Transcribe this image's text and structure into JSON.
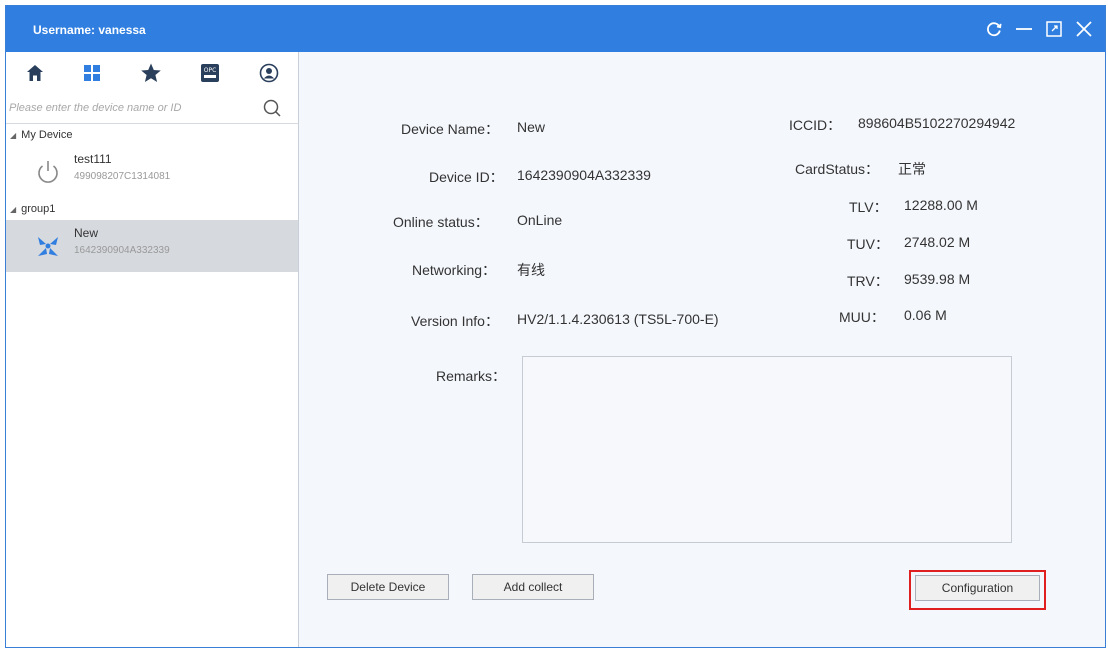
{
  "title_bar": {
    "username_label": "Username: vanessa",
    "controls": [
      "refresh-icon",
      "minimize-icon",
      "maximize-icon",
      "close-icon"
    ]
  },
  "sidebar": {
    "toolbar_icons": [
      "home-icon",
      "grid-icon",
      "star-icon",
      "opc-icon",
      "user-circle-icon"
    ],
    "search": {
      "placeholder": "Please enter the device name or ID",
      "value": ""
    },
    "groups": [
      {
        "name": "My Device",
        "devices": [
          {
            "name": "test111",
            "id": "499098207C1314081",
            "icon": "power-icon",
            "selected": false
          }
        ]
      },
      {
        "name": "group1",
        "devices": [
          {
            "name": "New",
            "id": "1642390904A332339",
            "icon": "device-x-icon",
            "selected": true
          }
        ]
      }
    ]
  },
  "details": {
    "device_name_label": "Device Name：",
    "device_name": "New",
    "device_id_label": "Device ID：",
    "device_id": "1642390904A332339",
    "online_status_label": "Online status：",
    "online_status": "OnLine",
    "networking_label": "Networking：",
    "networking": "有线",
    "version_info_label": "Version Info：",
    "version_info": "HV2/1.1.4.230613 (TS5L-700-E)",
    "remarks_label": "Remarks：",
    "remarks": "",
    "iccid_label": "ICCID：",
    "iccid": "898604B5102270294942",
    "card_status_label": "CardStatus：",
    "card_status": "正常",
    "tlv_label": "TLV：",
    "tlv": "12288.00 M",
    "tuv_label": "TUV：",
    "tuv": "2748.02 M",
    "trv_label": "TRV：",
    "trv": "9539.98 M",
    "muu_label": "MUU：",
    "muu": "0.06 M"
  },
  "buttons": {
    "delete_device": "Delete Device",
    "add_collect": "Add collect",
    "configuration": "Configuration"
  },
  "colors": {
    "titlebar": "#2f7ee0",
    "highlight": "#e02020",
    "selected_row": "#d6d9de"
  }
}
